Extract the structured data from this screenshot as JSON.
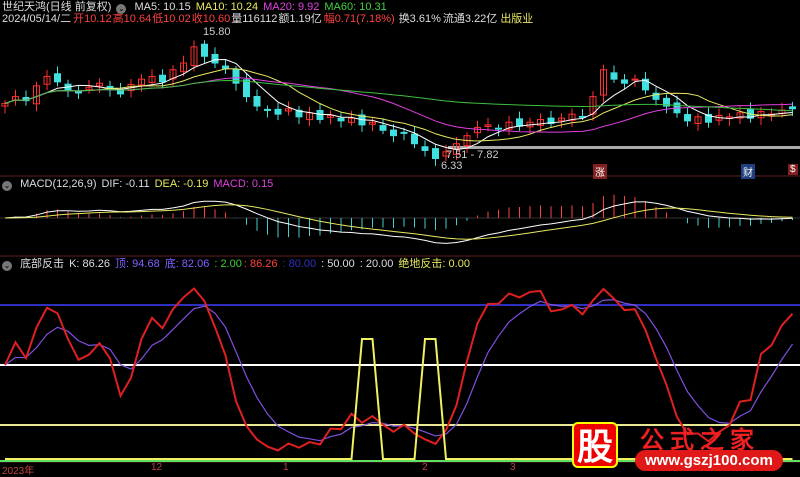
{
  "header": {
    "stock": "世纪天鸿(日线 前复权)",
    "ma5": "MA5: 10.15",
    "ma10": "MA10: 10.24",
    "ma20": "MA20: 9.92",
    "ma60": "MA60: 10.31",
    "date": "2024/05/14/二",
    "open": "开10.12",
    "high": "高10.64",
    "low": "低10.02",
    "close": "收10.60",
    "vol": "量116112",
    "amount": "额1.19亿",
    "change": "幅0.71(7.18%)",
    "turnover": "换3.61%",
    "float": "流通3.22亿",
    "industry": "出版业"
  },
  "macd_header": {
    "name": "MACD(12,26,9)",
    "dif": "DIF: -0.11",
    "dea": "DEA: -0.19",
    "macd": "MACD: 0.15"
  },
  "kdj_header": {
    "name": "底部反击",
    "k": "K: 86.26",
    "top": "顶: 94.68",
    "bottom": "底: 82.06",
    "v1": ": 2.00",
    "v2": ": 86.26",
    "v3": ": 80.00",
    "v4": ": 50.00",
    "v5": ": 20.00",
    "signal": "绝地反击: 0.00"
  },
  "annotations": {
    "high": "15.80",
    "low": "6.33",
    "range": "7.51 - 7.82",
    "tag1": "涨",
    "tag2": "财",
    "tag3": "$"
  },
  "xaxis": [
    "2023年",
    "12",
    "1",
    "2",
    "3"
  ],
  "logo": {
    "char": "股",
    "name": "公式之家",
    "url": "www.gszj100.com"
  },
  "colors": {
    "up": "#ff3030",
    "down": "#40e0e0",
    "ma5": "#ffffff",
    "ma10": "#e8e860",
    "ma20": "#e040e0",
    "ma60": "#40c040"
  },
  "chart_data": {
    "type": "candlestick",
    "title": "世纪天鸿(日线 前复权)",
    "close": [
      11.0,
      11.5,
      11.2,
      12.3,
      13.0,
      12.6,
      12.0,
      11.8,
      12.2,
      12.5,
      12.0,
      11.7,
      12.4,
      12.8,
      13.0,
      12.6,
      13.5,
      14.0,
      15.2,
      14.5,
      14.0,
      13.6,
      12.5,
      11.5,
      10.8,
      10.5,
      10.2,
      10.6,
      10.0,
      10.3,
      9.8,
      10.1,
      9.7,
      9.9,
      9.4,
      9.6,
      9.0,
      8.6,
      8.8,
      8.0,
      7.5,
      6.9,
      7.4,
      8.0,
      8.6,
      9.2,
      9.4,
      9.1,
      9.6,
      9.3,
      9.6,
      9.8,
      9.5,
      9.9,
      10.2,
      10.0,
      11.5,
      13.5,
      12.8,
      12.5,
      12.8,
      12.0,
      11.3,
      10.8,
      10.3,
      9.7,
      10.0,
      9.6,
      10.1,
      10.0,
      10.3,
      9.9,
      10.4,
      10.2,
      10.5,
      10.6
    ],
    "price_range": [
      5.9,
      16.6
    ],
    "kdj_levels": [
      80,
      50,
      20,
      2
    ],
    "signal_spikes": [
      34,
      35,
      40,
      41
    ]
  }
}
